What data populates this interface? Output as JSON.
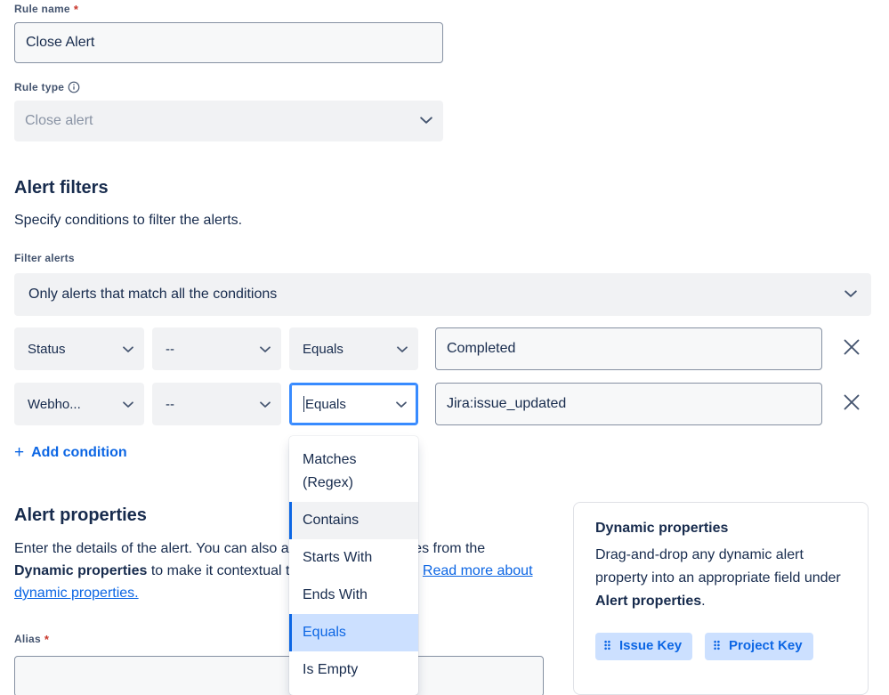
{
  "form": {
    "rule_name": {
      "label": "Rule name",
      "required_marker": "*",
      "value": "Close Alert"
    },
    "rule_type": {
      "label": "Rule type",
      "info_icon": "info-circle-icon",
      "value": "Close alert",
      "caret_icon": "chevron-down-icon"
    }
  },
  "alert_filters": {
    "title": "Alert filters",
    "description": "Specify conditions to filter the alerts.",
    "filter_alerts_label": "Filter alerts",
    "filter_alerts_value": "Only alerts that match all the conditions",
    "caret_icon": "chevron-down-icon",
    "conditions": [
      {
        "field": "Status",
        "key": "--",
        "operator": "Equals",
        "value": "Completed",
        "remove_icon": "close-icon"
      },
      {
        "field": "Webho...",
        "key": "--",
        "operator": "Equals",
        "value": "Jira:issue_updated",
        "remove_icon": "close-icon"
      }
    ],
    "add_condition": {
      "plus": "+",
      "label": "Add condition"
    }
  },
  "operator_dropdown": {
    "open": true,
    "items": [
      {
        "label": "Matches (Regex)",
        "state": "normal"
      },
      {
        "label": "Contains",
        "state": "hover"
      },
      {
        "label": "Starts With",
        "state": "normal"
      },
      {
        "label": "Ends With",
        "state": "normal"
      },
      {
        "label": "Equals",
        "state": "selected"
      },
      {
        "label": "Is Empty",
        "state": "normal"
      }
    ]
  },
  "alert_properties": {
    "title": "Alert properties",
    "paragraph_part1": "Enter the details of the alert. You can also add dynamic properites from the ",
    "paragraph_bold1": "Dynamic properties",
    "paragraph_part2": " to make it contextual to your configuration. ",
    "paragraph_link": "Read more about dynamic properties.",
    "alias_label": "Alias",
    "alias_required_marker": "*",
    "alias_value": ""
  },
  "dynamic_properties": {
    "title": "Dynamic properties",
    "desc_part1": "Drag-and-drop any dynamic alert property into an appropriate field under ",
    "desc_bold": "Alert properties",
    "desc_part2": ".",
    "chips": [
      {
        "grip": "⠿",
        "label": "Issue Key"
      },
      {
        "grip": "⠿",
        "label": "Project Key"
      }
    ]
  },
  "colors": {
    "accent_blue": "#0c66e4",
    "focus_blue": "#388bff",
    "chip_bg": "#cce0ff",
    "field_bg": "#f1f2f4",
    "input_bg": "#f7f8f9",
    "required_red": "#c9372c",
    "text": "#172b4d",
    "subtle_text": "#44546f"
  }
}
